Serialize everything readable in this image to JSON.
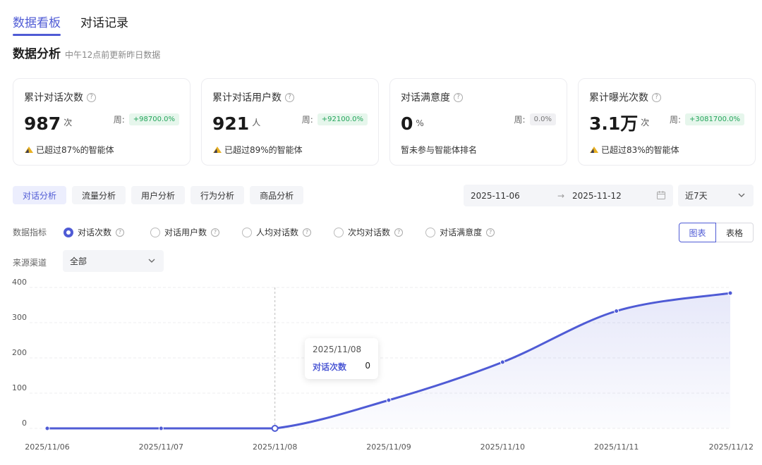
{
  "top_tabs": [
    {
      "label": "数据看板"
    },
    {
      "label": "对话记录"
    }
  ],
  "header": {
    "title": "数据分析",
    "subtitle": "中午12点前更新昨日数据"
  },
  "cards": [
    {
      "label": "累计对话次数",
      "value": "987",
      "unit": "次",
      "week_label": "周:",
      "week_change": "+98700.0%",
      "footnote": "已超过87%的智能体"
    },
    {
      "label": "累计对话用户数",
      "value": "921",
      "unit": "人",
      "week_label": "周:",
      "week_change": "+92100.0%",
      "footnote": "已超过89%的智能体"
    },
    {
      "label": "对话满意度",
      "value": "0",
      "unit": "%",
      "week_label": "周:",
      "week_change": "0.0%",
      "footnote": "暂未参与智能体排名"
    },
    {
      "label": "累计曝光次数",
      "value": "3.1万",
      "unit": "次",
      "week_label": "周:",
      "week_change": "+3081700.0%",
      "footnote": "已超过83%的智能体"
    }
  ],
  "sub_tabs": [
    {
      "label": "对话分析"
    },
    {
      "label": "流量分析"
    },
    {
      "label": "用户分析"
    },
    {
      "label": "行为分析"
    },
    {
      "label": "商品分析"
    }
  ],
  "date_range": {
    "start": "2025-11-06",
    "arrow": "→",
    "end": "2025-11-12"
  },
  "period": {
    "selected": "近7天"
  },
  "metrics": {
    "label": "数据指标",
    "options": [
      {
        "label": "对话次数"
      },
      {
        "label": "对话用户数"
      },
      {
        "label": "人均对话数"
      },
      {
        "label": "次均对话数"
      },
      {
        "label": "对话满意度"
      }
    ]
  },
  "view_toggle": {
    "chart": "图表",
    "table": "表格"
  },
  "source": {
    "label": "来源渠道",
    "selected": "全部"
  },
  "tooltip": {
    "date": "2025/11/08",
    "series": "对话次数",
    "value": "0"
  },
  "colors": {
    "accent": "#4f5bd5",
    "up": "#23a55a"
  },
  "chart_data": {
    "type": "area",
    "categories": [
      "2025/11/06",
      "2025/11/07",
      "2025/11/08",
      "2025/11/09",
      "2025/11/10",
      "2025/11/11",
      "2025/11/12"
    ],
    "series": [
      {
        "values": [
          0,
          0,
          0,
          80,
          188,
          333,
          384
        ]
      }
    ],
    "yticks": [
      0,
      100,
      200,
      300,
      400
    ],
    "ylim": [
      0,
      400
    ],
    "grid": true,
    "highlight_index": 2
  }
}
